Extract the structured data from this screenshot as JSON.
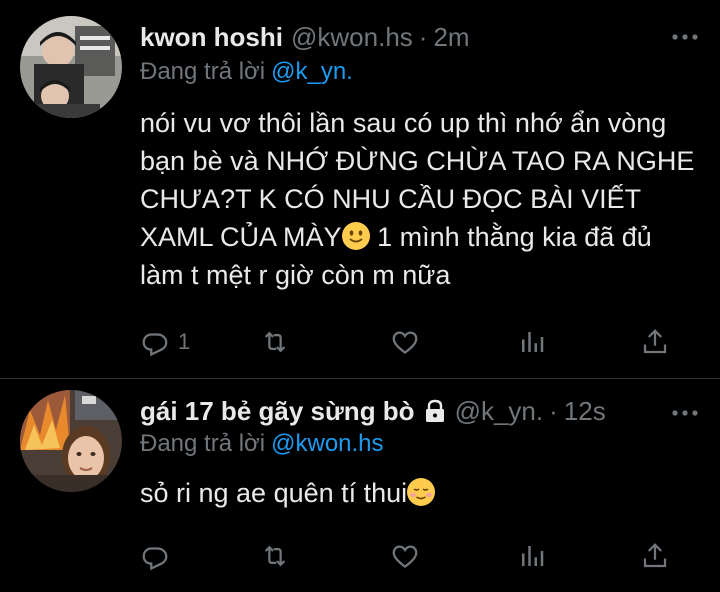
{
  "tweets": [
    {
      "name": "kwon hoshi",
      "handle": "@kwon.hs",
      "separator": "·",
      "time": "2m",
      "replying_prefix": "Đang trả lời",
      "replying_to": "@k_yn.",
      "text_before_emoji": "nói vu vơ thôi lần sau có up thì nhớ ẩn vòng bạn bè và NHỚ ĐỪNG CHỪA TAO RA NGHE CHƯA?T K CÓ NHU CẦU ĐỌC BÀI VIẾT XAML CỦA MÀY",
      "emoji": "slightly-smiling-face",
      "text_after_emoji": " 1 mình thằng kia đã đủ làm t mệt r giờ còn m nữa",
      "reply_count": "1",
      "protected": false
    },
    {
      "name": "gái 17 bẻ gãy sừng bò",
      "handle": "@k_yn.",
      "separator": "·",
      "time": "12s",
      "replying_prefix": "Đang trả lời",
      "replying_to": "@kwon.hs",
      "text_before_emoji": "sỏ ri ng ae quên tí thui",
      "emoji": "relieved-face",
      "text_after_emoji": "",
      "reply_count": "",
      "protected": true
    }
  ],
  "colors": {
    "background": "#000000",
    "text": "#e7e9ea",
    "secondary": "#71767b",
    "link": "#1d9bf0",
    "divider": "#2f3336"
  },
  "icons": [
    "reply-icon",
    "retweet-icon",
    "like-icon",
    "analytics-icon",
    "share-icon",
    "more-icon",
    "lock-icon"
  ]
}
